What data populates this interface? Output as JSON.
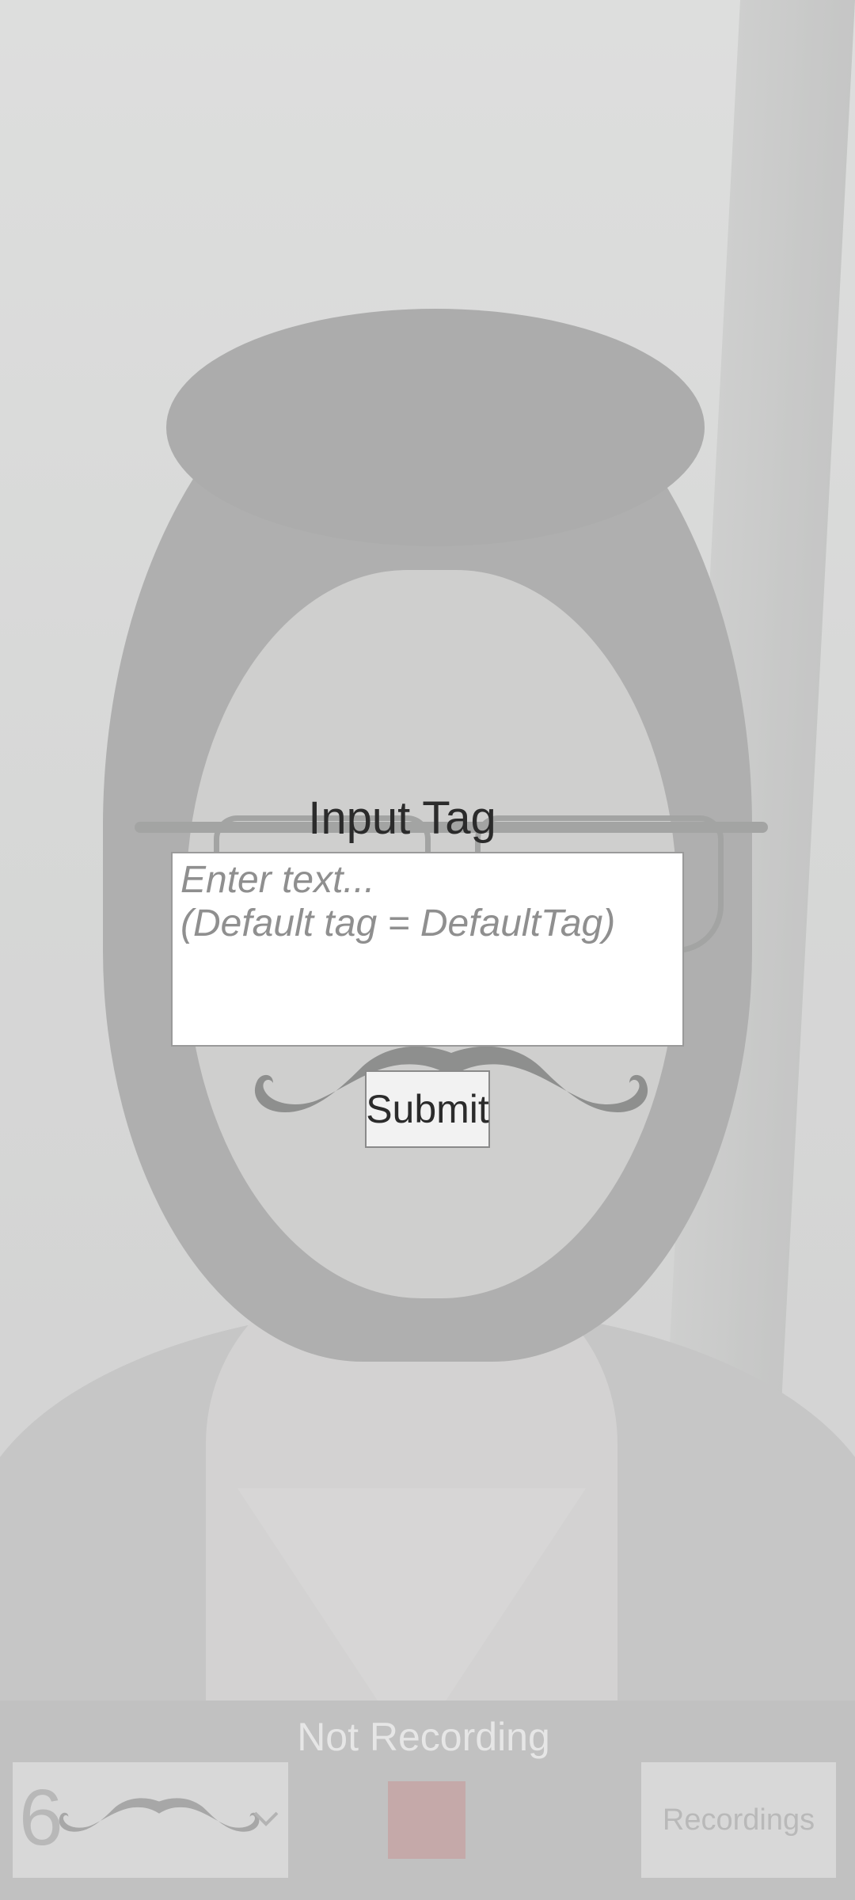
{
  "dialog": {
    "title": "Input Tag",
    "input_value": "",
    "input_placeholder": "Enter text...\n(Default tag = DefaultTag)",
    "submit_label": "Submit"
  },
  "bottom_bar": {
    "status": "Not Recording",
    "selector_number": "6",
    "selector_icon": "mustache-icon",
    "recordings_label": "Recordings"
  },
  "colors": {
    "record_button": "#c5a9a9",
    "bar_background": "#c1c1c1"
  }
}
